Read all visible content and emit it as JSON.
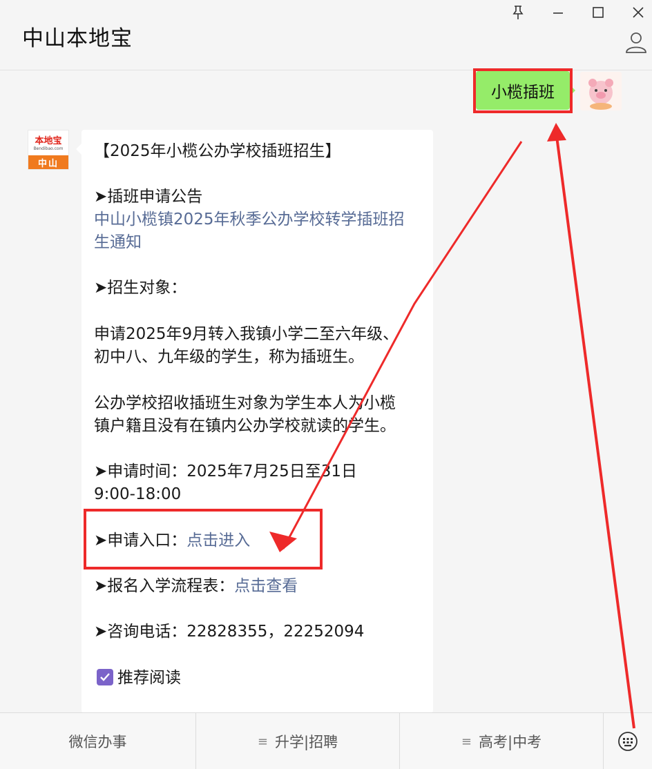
{
  "window": {
    "title": "中山本地宝"
  },
  "chat": {
    "outgoing_message": "小榄插班",
    "bot_logo_main": "本地宝",
    "bot_logo_sub": "Bendibao.com",
    "bot_logo_city": "中山",
    "lines": {
      "title": "【2025年小榄公办学校插班招生】",
      "notice_heading": "➤插班申请公告",
      "notice_link_1": "中山小榄镇2025年秋季公办学校转学插班招",
      "notice_link_2": "生通知",
      "target_heading": "➤招生对象：",
      "target_p1_1": "申请2025年9月转入我镇小学二至六年级、",
      "target_p1_2": "初中八、九年级的学生，称为插班生。",
      "target_p2_1": "公办学校招收插班生对象为学生本人为小榄",
      "target_p2_2": "镇户籍且没有在镇内公办学校就读的学生。",
      "time_1": "➤申请时间：2025年7月25日至31日",
      "time_2": "9:00-18:00",
      "entry_label": "➤申请入口：",
      "entry_link": "点击进入",
      "flow_label": "➤报名入学流程表：",
      "flow_link": "点击查看",
      "phone": "➤咨询电话：22828355，22252094",
      "recommend": "推荐阅读"
    }
  },
  "menu": {
    "item1": "微信办事",
    "item2": "升学|招聘",
    "item3": "高考|中考",
    "lines_icon": "≡"
  },
  "colors": {
    "annotation_red": "#ee2a2a",
    "bubble_green": "#95ec69",
    "link_blue": "#576b95",
    "check_purple": "#7b63c9"
  }
}
